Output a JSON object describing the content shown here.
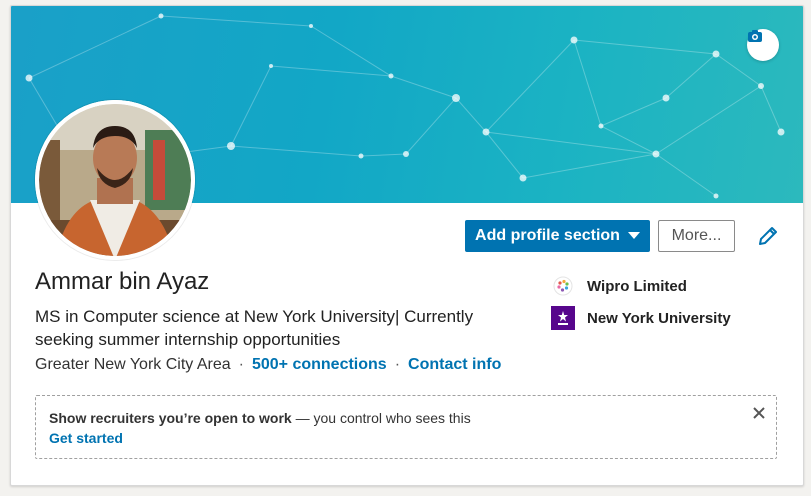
{
  "profile": {
    "name": "Ammar bin Ayaz",
    "headline": "MS in Computer science at New York University| Currently seeking summer internship opportunities",
    "location": "Greater New York City Area",
    "connections": "500+ connections",
    "contact": "Contact info"
  },
  "actions": {
    "add_section": "Add profile section",
    "more": "More..."
  },
  "sidebar": {
    "items": [
      {
        "label": "Wipro Limited",
        "icon": "wipro-logo"
      },
      {
        "label": "New York University",
        "icon": "nyu-logo"
      }
    ]
  },
  "open_to_work": {
    "title": "Show recruiters you’re open to work",
    "subtitle": " — you control who sees this",
    "cta": "Get started"
  },
  "icons": {
    "camera": "camera-icon",
    "edit": "pencil-icon",
    "close": "close-icon",
    "dropdown": "caret-down-icon"
  },
  "colors": {
    "accent": "#0073b1",
    "banner": "#1aa8c6",
    "nyu": "#57068c"
  }
}
